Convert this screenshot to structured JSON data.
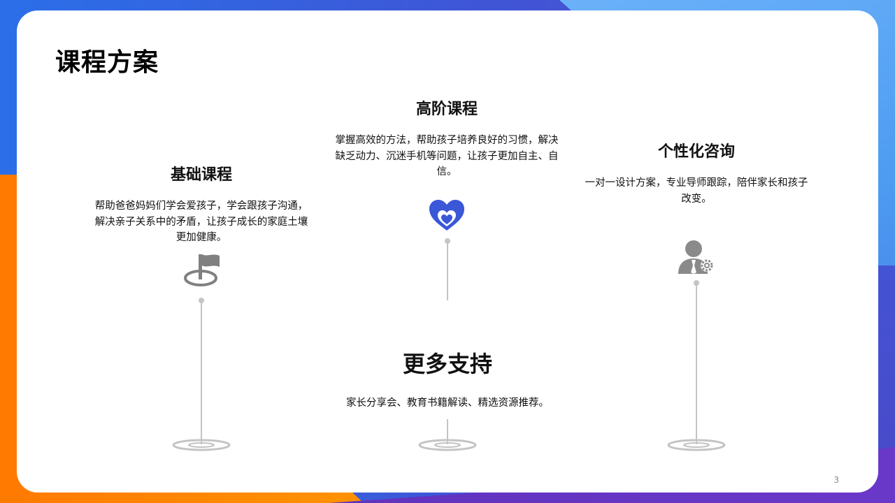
{
  "page": {
    "title": "课程方案",
    "number": "3"
  },
  "sections": [
    {
      "title": "基础课程",
      "text": "帮助爸爸妈妈们学会爱孩子，学会跟孩子沟通，解决亲子关系中的矛盾，让孩子成长的家庭土壤更加健康。",
      "icon": "flag-icon"
    },
    {
      "title": "高阶课程",
      "text": "掌握高效的方法，帮助孩子培养良好的习惯，解决缺乏动力、沉迷手机等问题，让孩子更加自主、自信。",
      "icon": "hearts-icon"
    },
    {
      "title": "个性化咨询",
      "text": "一对一设计方案，专业导师跟踪，陪伴家长和孩子改变。",
      "icon": "consultant-gear-icon"
    },
    {
      "title": "更多支持",
      "text": "家长分享会、教育书籍解读、精选资源推荐。",
      "icon": ""
    }
  ],
  "colors": {
    "heart": "#3a57d8",
    "icon_gray": "#8a8a8a",
    "line_gray": "#c4c4c4",
    "orange": "#ff7a00",
    "blue": "#2b6fe8"
  }
}
